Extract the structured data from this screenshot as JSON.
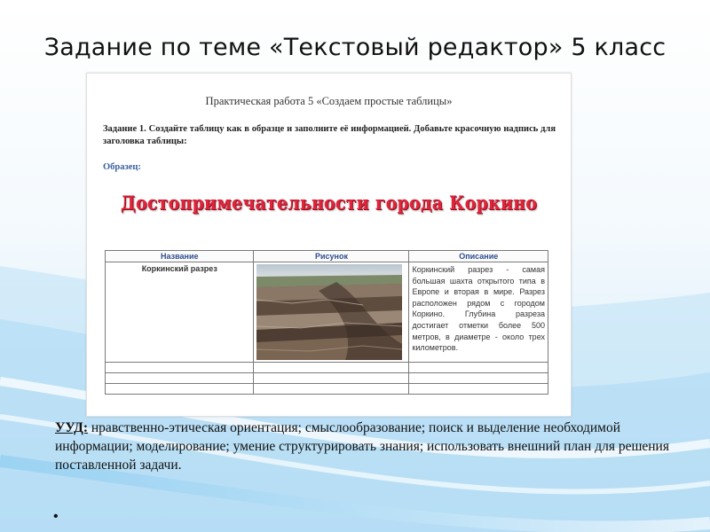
{
  "slide": {
    "title": "Задание по теме «Текстовый редактор» 5 класс"
  },
  "document": {
    "heading": "Практическая работа 5 «Создаем простые таблицы»",
    "task": "Задание 1. Создайте таблицу как в образце и заполните её информацией. Добавьте красочную надпись для заголовка таблицы:",
    "sample_label": "Образец:",
    "wordart": "Достопримечательности города Коркино",
    "table": {
      "headers": [
        "Название",
        "Рисунок",
        "Описание"
      ],
      "row": {
        "name": "Коркинский разрез",
        "picture_icon": "quarry-photo",
        "description": "Коркинский разрез - самая большая шахта открытого типа в Европе и вторая в мире. Разрез расположен рядом с городом Коркино. Глубина разреза достигает отметки более 500 метров, в диаметре - около трех километров."
      },
      "empty_rows": 3
    }
  },
  "uud": {
    "label": "УУД:",
    "text": " нравственно-этическая ориентация; смыслообразование; поиск и выделение необходимой информации; моделирование; умение структурировать знания; использовать внешний план для решения поставленной задачи."
  },
  "bullet": "•",
  "colors": {
    "wordart": "#e0243a",
    "table_header": "#2e4d8f",
    "sample_label": "#3a5fa0",
    "background_accent": "#5ab3e6"
  }
}
